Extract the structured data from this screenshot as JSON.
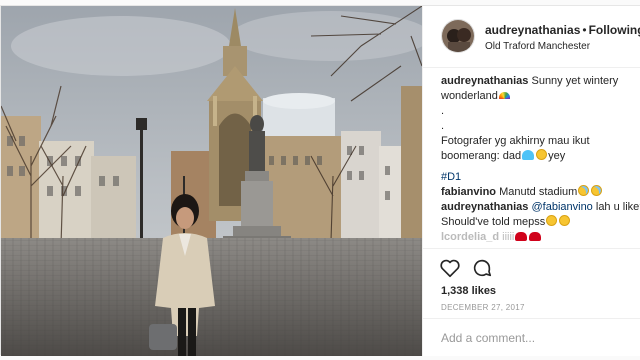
{
  "post": {
    "username": "audreynathanias",
    "separator": "•",
    "follow_label": "Following",
    "location": "Old Traford Manchester"
  },
  "caption": {
    "username": "audreynathanias",
    "line1": "Sunny yet wintery",
    "line2": "wonderland",
    "dot1": ".",
    "dot2": ".",
    "line3": "Fotografer yg akhirny mau ikut",
    "line4a": "boomerang: dad",
    "line4b": "yey",
    "hashtag": "#D1"
  },
  "comments": [
    {
      "username": "fabianvino",
      "text": "Manutd stadium"
    },
    {
      "username": "audreynathanias",
      "mention": "@fabianvino",
      "text": "lah u like??",
      "text2": "Should've told mepss"
    }
  ],
  "faded_comment": {
    "username": "lcordelia_d",
    "text": "iiiii"
  },
  "actions": {
    "like_icon": "heart-outline-icon",
    "comment_icon": "speech-bubble-icon"
  },
  "likes": "1,338 likes",
  "date": "DECEMBER 27, 2017",
  "add_comment": {
    "placeholder": "Add a comment..."
  },
  "colors": {
    "link": "#003569",
    "text": "#262626",
    "muted": "#999999",
    "border": "#efefef"
  }
}
